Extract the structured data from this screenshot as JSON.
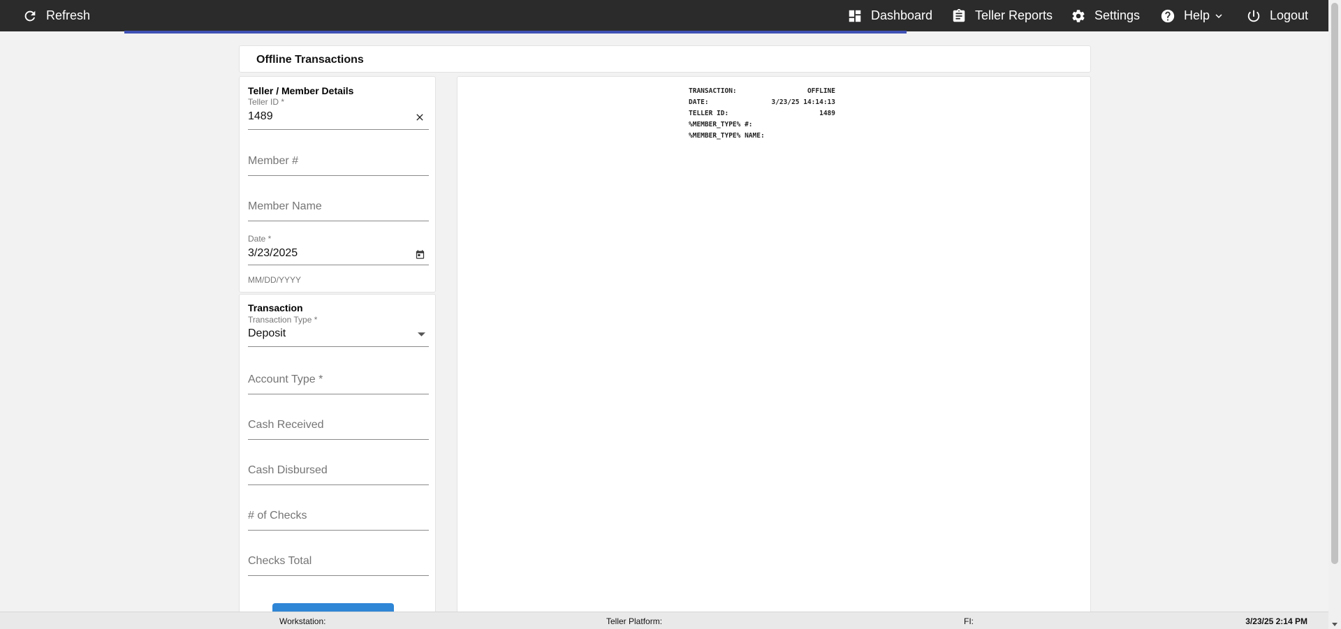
{
  "topbar": {
    "refresh": "Refresh",
    "dashboard": "Dashboard",
    "teller_reports": "Teller Reports",
    "settings": "Settings",
    "help": "Help",
    "logout": "Logout",
    "accent_color": "#3f51b5"
  },
  "title": "Offline Transactions",
  "teller_member": {
    "heading": "Teller / Member Details",
    "teller_id_label": "Teller ID *",
    "teller_id_value": "1489",
    "member_number_placeholder": "Member #",
    "member_name_placeholder": "Member Name",
    "date_label": "Date *",
    "date_value": "3/23/2025",
    "date_helper": "MM/DD/YYYY"
  },
  "transaction": {
    "heading": "Transaction",
    "type_label": "Transaction Type *",
    "type_value": "Deposit",
    "account_type_placeholder": "Account Type *",
    "cash_received_placeholder": "Cash Received",
    "cash_disbursed_placeholder": "Cash Disbursed",
    "num_checks_placeholder": "# of Checks",
    "checks_total_placeholder": "Checks Total"
  },
  "receipt": [
    {
      "label": "TRANSACTION:",
      "value": "OFFLINE"
    },
    {
      "label": "DATE:",
      "value": "3/23/25 14:14:13"
    },
    {
      "label": "TELLER ID:",
      "value": "1489"
    },
    {
      "label": "%MEMBER_TYPE% #:",
      "value": ""
    },
    {
      "label": "%MEMBER_TYPE% NAME:",
      "value": ""
    }
  ],
  "statusbar": {
    "workstation": "Workstation:",
    "teller_platform": "Teller Platform:",
    "fi": "FI:",
    "datetime": "3/23/25 2:14 PM"
  }
}
